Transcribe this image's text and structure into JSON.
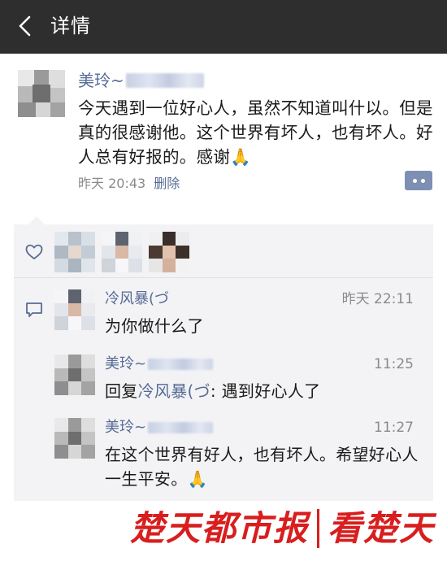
{
  "navbar": {
    "title": "详情",
    "back_icon": "chevron-left-icon"
  },
  "post": {
    "author": "美玲~",
    "text": "今天遇到一位好心人，虽然不知道叫什以。但是真的很感谢他。这个世界有坏人，也有坏人。好人总有好报的。感谢🙏",
    "time": "昨天 20:43",
    "delete_label": "删除",
    "more_icon": "more-dots-icon"
  },
  "likes": {
    "icon": "heart-icon"
  },
  "comments": [
    {
      "name": "冷风暴(づ",
      "time": "昨天 22:11",
      "text": "为你做什么了"
    },
    {
      "name": "美玲~",
      "time": "11:25",
      "reply_prefix": "回复",
      "reply_to": "冷风暴(づ",
      "reply_text": ": 遇到好心人了"
    },
    {
      "name": "美玲~",
      "time": "11:27",
      "text": "在这个世界有好人，也有坏人。希望好心人一生平安。🙏"
    }
  ],
  "watermark": {
    "left": "楚天都市报",
    "right": "看楚天"
  },
  "colors": {
    "navbar": "#2e2e2e",
    "link": "#576b95",
    "watermark": "#d81e1e",
    "panel": "#f3f3f5"
  }
}
